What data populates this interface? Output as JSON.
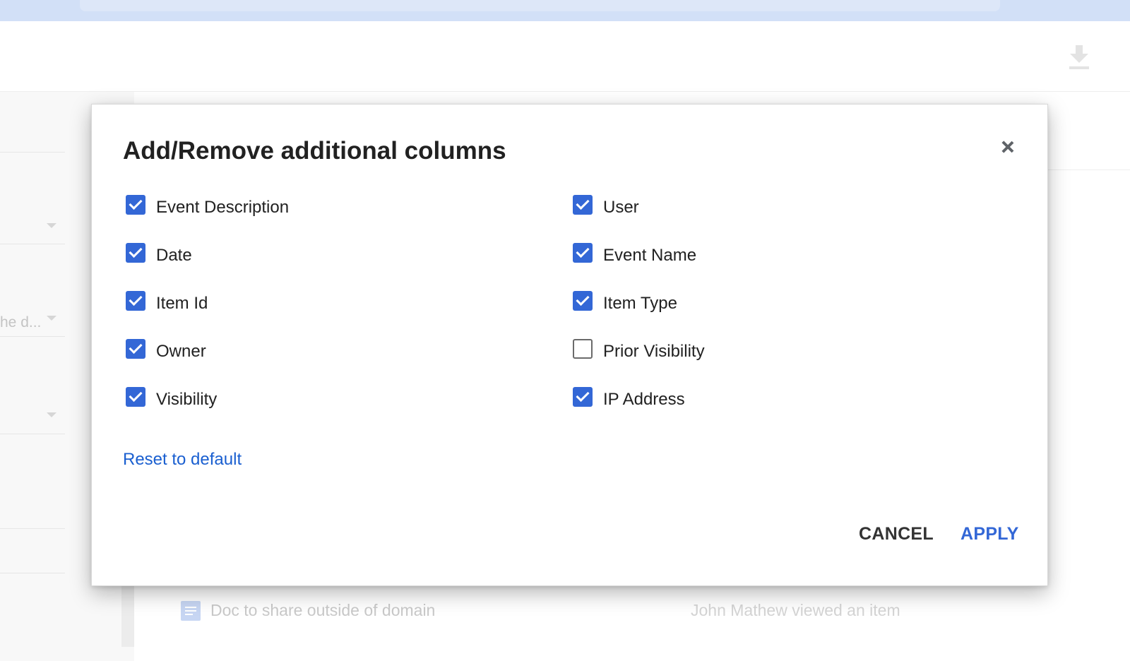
{
  "background": {
    "filter_value_truncated": "he d...",
    "row": {
      "item_name": "Doc to share outside of domain",
      "event_description": "John Mathew viewed an item"
    }
  },
  "dialog": {
    "title": "Add/Remove additional columns",
    "close_icon": "close-icon",
    "left_column": [
      {
        "label": "Event Description",
        "checked": true
      },
      {
        "label": "Date",
        "checked": true
      },
      {
        "label": "Item Id",
        "checked": true
      },
      {
        "label": "Owner",
        "checked": true
      },
      {
        "label": "Visibility",
        "checked": true
      }
    ],
    "right_column": [
      {
        "label": "User",
        "checked": true
      },
      {
        "label": "Event Name",
        "checked": true
      },
      {
        "label": "Item Type",
        "checked": true
      },
      {
        "label": "Prior Visibility",
        "checked": false
      },
      {
        "label": "IP Address",
        "checked": true
      }
    ],
    "reset_label": "Reset to default",
    "cancel_label": "CANCEL",
    "apply_label": "APPLY"
  },
  "colors": {
    "accent": "#3367d6",
    "link": "#1a5fd0",
    "title_text": "#212121"
  }
}
